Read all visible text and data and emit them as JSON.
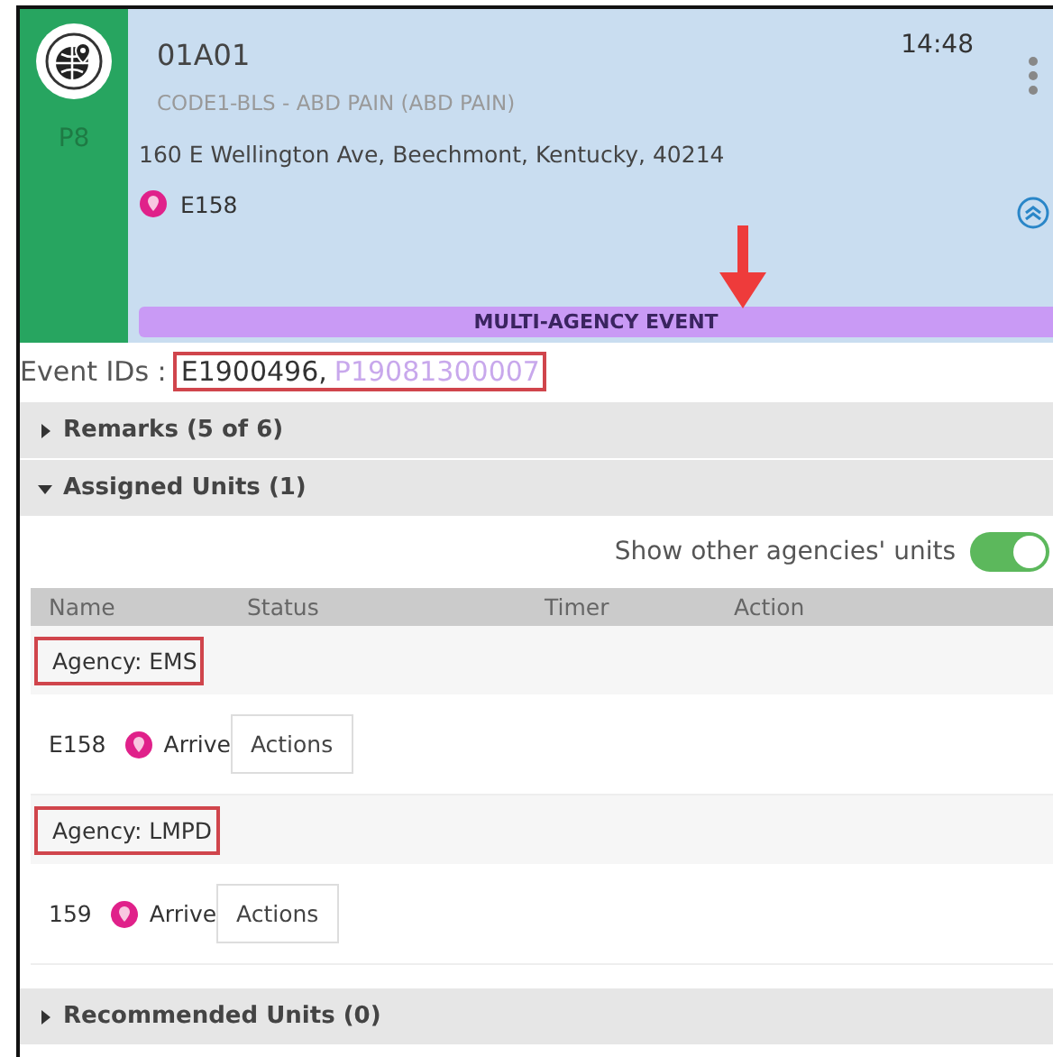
{
  "event": {
    "priority": "P8",
    "code": "01A01",
    "time": "14:48",
    "type": "CODE1-BLS - ABD PAIN (ABD PAIN)",
    "address": "160 E Wellington Ave, Beechmont, Kentucky, 40214",
    "unit": "E158",
    "banner": "MULTI-AGENCY EVENT"
  },
  "event_ids": {
    "label": "Event IDs :",
    "ids": [
      {
        "text": "E1900496,",
        "kind": "primary"
      },
      {
        "text": "P19081300007",
        "kind": "linked"
      }
    ]
  },
  "remarks": {
    "title": "Remarks (5 of 6)",
    "expanded": false
  },
  "assigned_units": {
    "title": "Assigned Units (1)",
    "expanded": true,
    "toggle": {
      "label": "Show other agencies' units",
      "on": true
    },
    "columns": [
      "Name",
      "Status",
      "Timer",
      "Action"
    ],
    "groups": [
      {
        "agency": "Agency: EMS",
        "units": [
          {
            "name": "E158",
            "status": "Arrive",
            "action": "Actions"
          }
        ]
      },
      {
        "agency": "Agency: LMPD",
        "units": [
          {
            "name": "159",
            "status": "Arrive",
            "action": "Actions"
          }
        ]
      }
    ]
  },
  "recommended_units": {
    "title": "Recommended Units (0)",
    "expanded": false
  }
}
